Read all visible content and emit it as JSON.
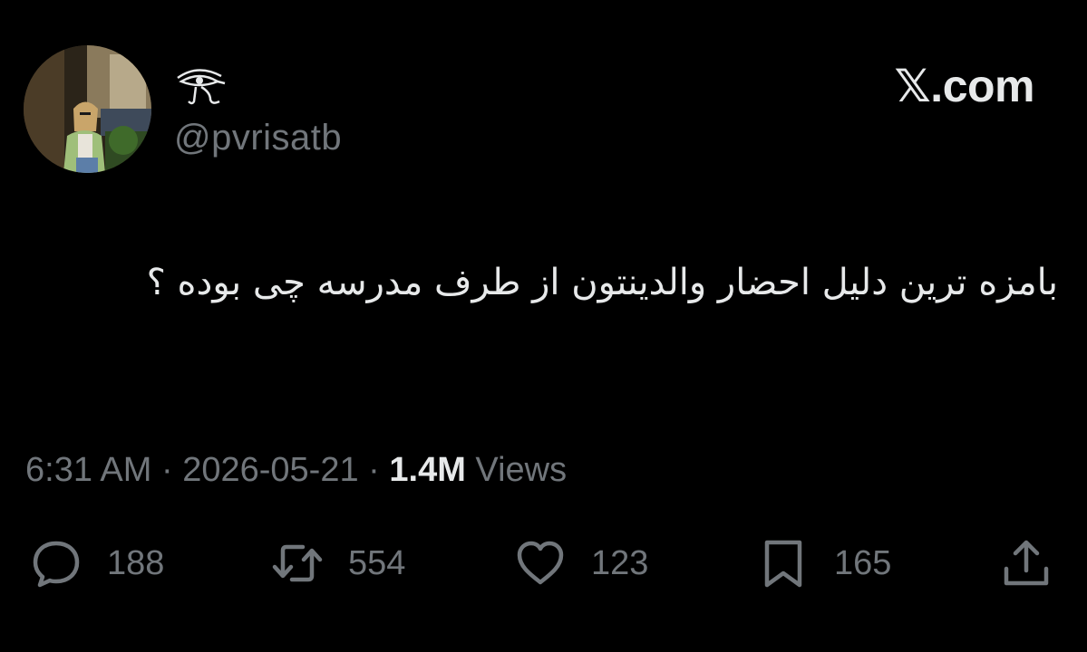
{
  "header": {
    "brand": "𝕏.com",
    "handle": "@pvrisatb",
    "display_name_icon": "eye-of-horus-icon"
  },
  "tweet": {
    "text": "بامزه ترین دلیل احضار والدینتون از طرف مدرسه چی بوده ؟"
  },
  "meta": {
    "time": "6:31 AM",
    "separator": "·",
    "date": "2026-05-21",
    "views_count": "1.4M",
    "views_label": "Views"
  },
  "actions": {
    "reply": {
      "icon": "reply-bubble-icon",
      "count": "188"
    },
    "retweet": {
      "icon": "retweet-icon",
      "count": "554"
    },
    "like": {
      "icon": "heart-icon",
      "count": "123"
    },
    "bookmark": {
      "icon": "bookmark-icon",
      "count": "165"
    },
    "share": {
      "icon": "share-icon"
    }
  },
  "colors": {
    "background": "#000000",
    "primary_text": "#e7e9ea",
    "secondary_text": "#71767b"
  }
}
